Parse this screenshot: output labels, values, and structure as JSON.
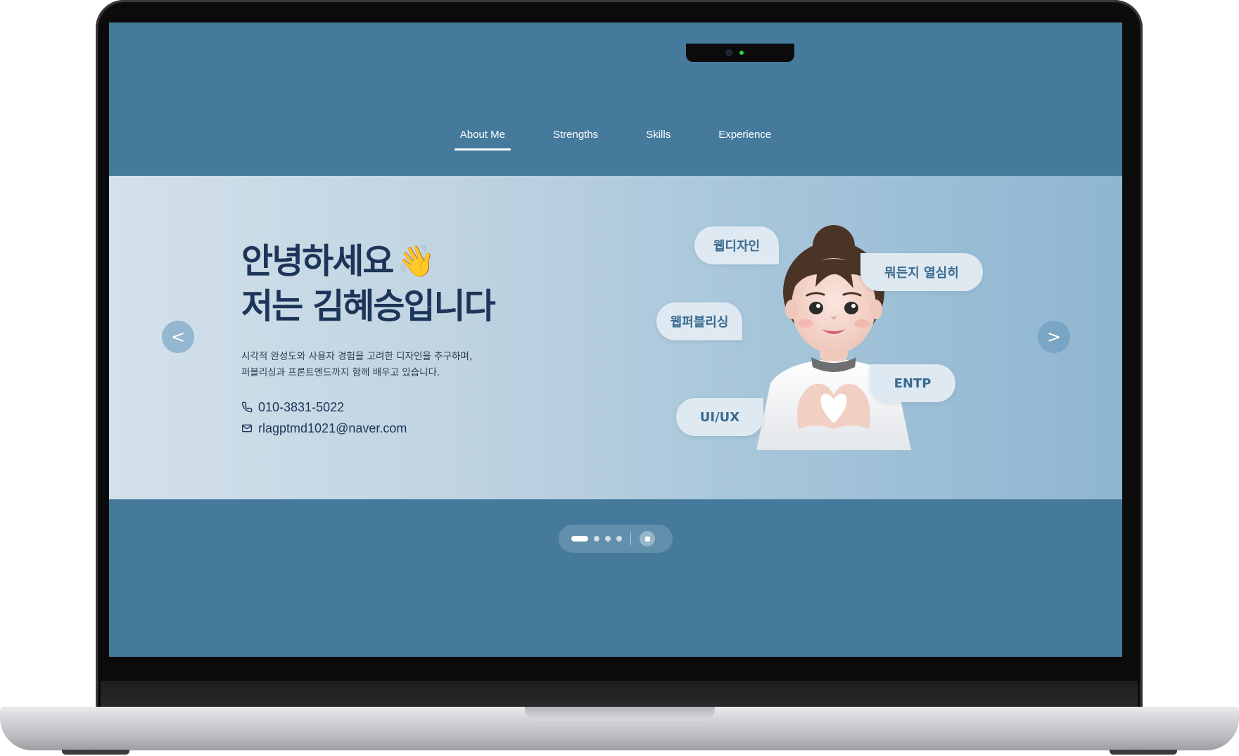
{
  "nav": {
    "items": [
      {
        "label": "About Me",
        "active": true
      },
      {
        "label": "Strengths",
        "active": false
      },
      {
        "label": "Skills",
        "active": false
      },
      {
        "label": "Experience",
        "active": false
      }
    ]
  },
  "hero": {
    "greeting_line1": "안녕하세요",
    "wave_emoji": "👋",
    "greeting_line2": "저는 김혜승입니다",
    "description_line1": "시각적 완성도와 사용자 경험을 고려한 디자인을 추구하며,",
    "description_line2": "퍼블리싱과 프론트엔드까지 함께 배우고 있습니다.",
    "phone": "010-3831-5022",
    "email": "rlagptmd1021@naver.com",
    "prev_label": "<",
    "next_label": ">",
    "tags": [
      "웹디자인",
      "뭐든지 열심히",
      "웹퍼블리싱",
      "ENTP",
      "UI/UX"
    ]
  },
  "pagination": {
    "slide_count": 4,
    "active_index": 0
  },
  "colors": {
    "page_bg": "#457a9d",
    "heading": "#1c3559",
    "tag_text": "#3a6a8f",
    "tag_bg": "#dfe9f1"
  },
  "icons": {
    "phone": "phone-icon",
    "mail": "mail-icon",
    "stop": "stop-icon",
    "avatar": "memoji-avatar"
  }
}
